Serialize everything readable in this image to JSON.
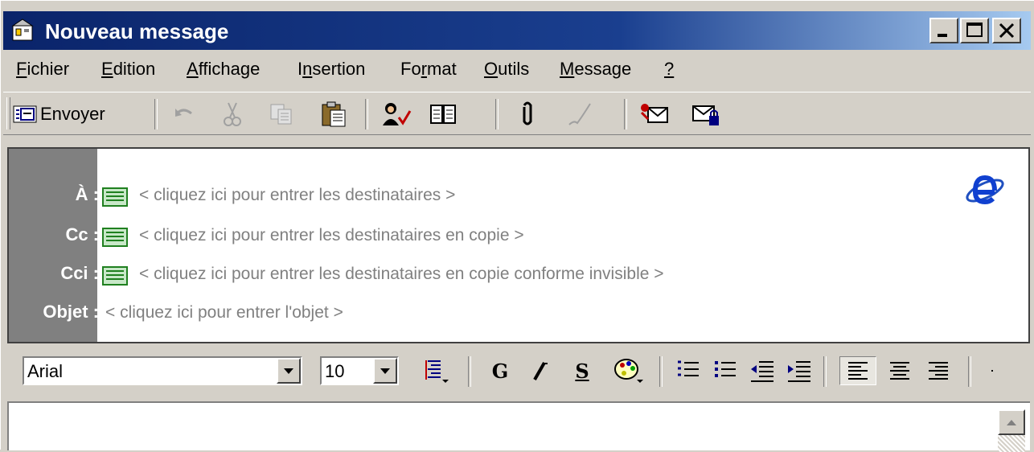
{
  "titlebar": {
    "title": "Nouveau message"
  },
  "menu": [
    {
      "acc": "F",
      "rest": "ichier"
    },
    {
      "acc": "E",
      "rest": "dition"
    },
    {
      "acc": "A",
      "rest": "ffichage"
    },
    {
      "pre": "I",
      "acc": "n",
      "rest": "sertion"
    },
    {
      "pre": "Fo",
      "acc": "r",
      "rest": "mat"
    },
    {
      "acc": "O",
      "rest": "utils"
    },
    {
      "acc": "M",
      "rest": "essage"
    },
    {
      "acc": "?",
      "rest": ""
    }
  ],
  "toolbar": {
    "send_label": "Envoyer"
  },
  "header": {
    "to_label": "À :",
    "to_placeholder": "< cliquez ici pour entrer les destinataires >",
    "cc_label": "Cc :",
    "cc_placeholder": "< cliquez ici pour entrer les destinataires en copie >",
    "bcc_label": "Cci :",
    "bcc_placeholder": "< cliquez ici pour entrer les destinataires en copie conforme invisible >",
    "subject_label": "Objet :",
    "subject_placeholder": "< cliquez ici pour entrer l'objet >"
  },
  "format": {
    "font": "Arial",
    "size": "10",
    "bold_label": "G",
    "italic_label": "I",
    "underline_label": "S"
  }
}
